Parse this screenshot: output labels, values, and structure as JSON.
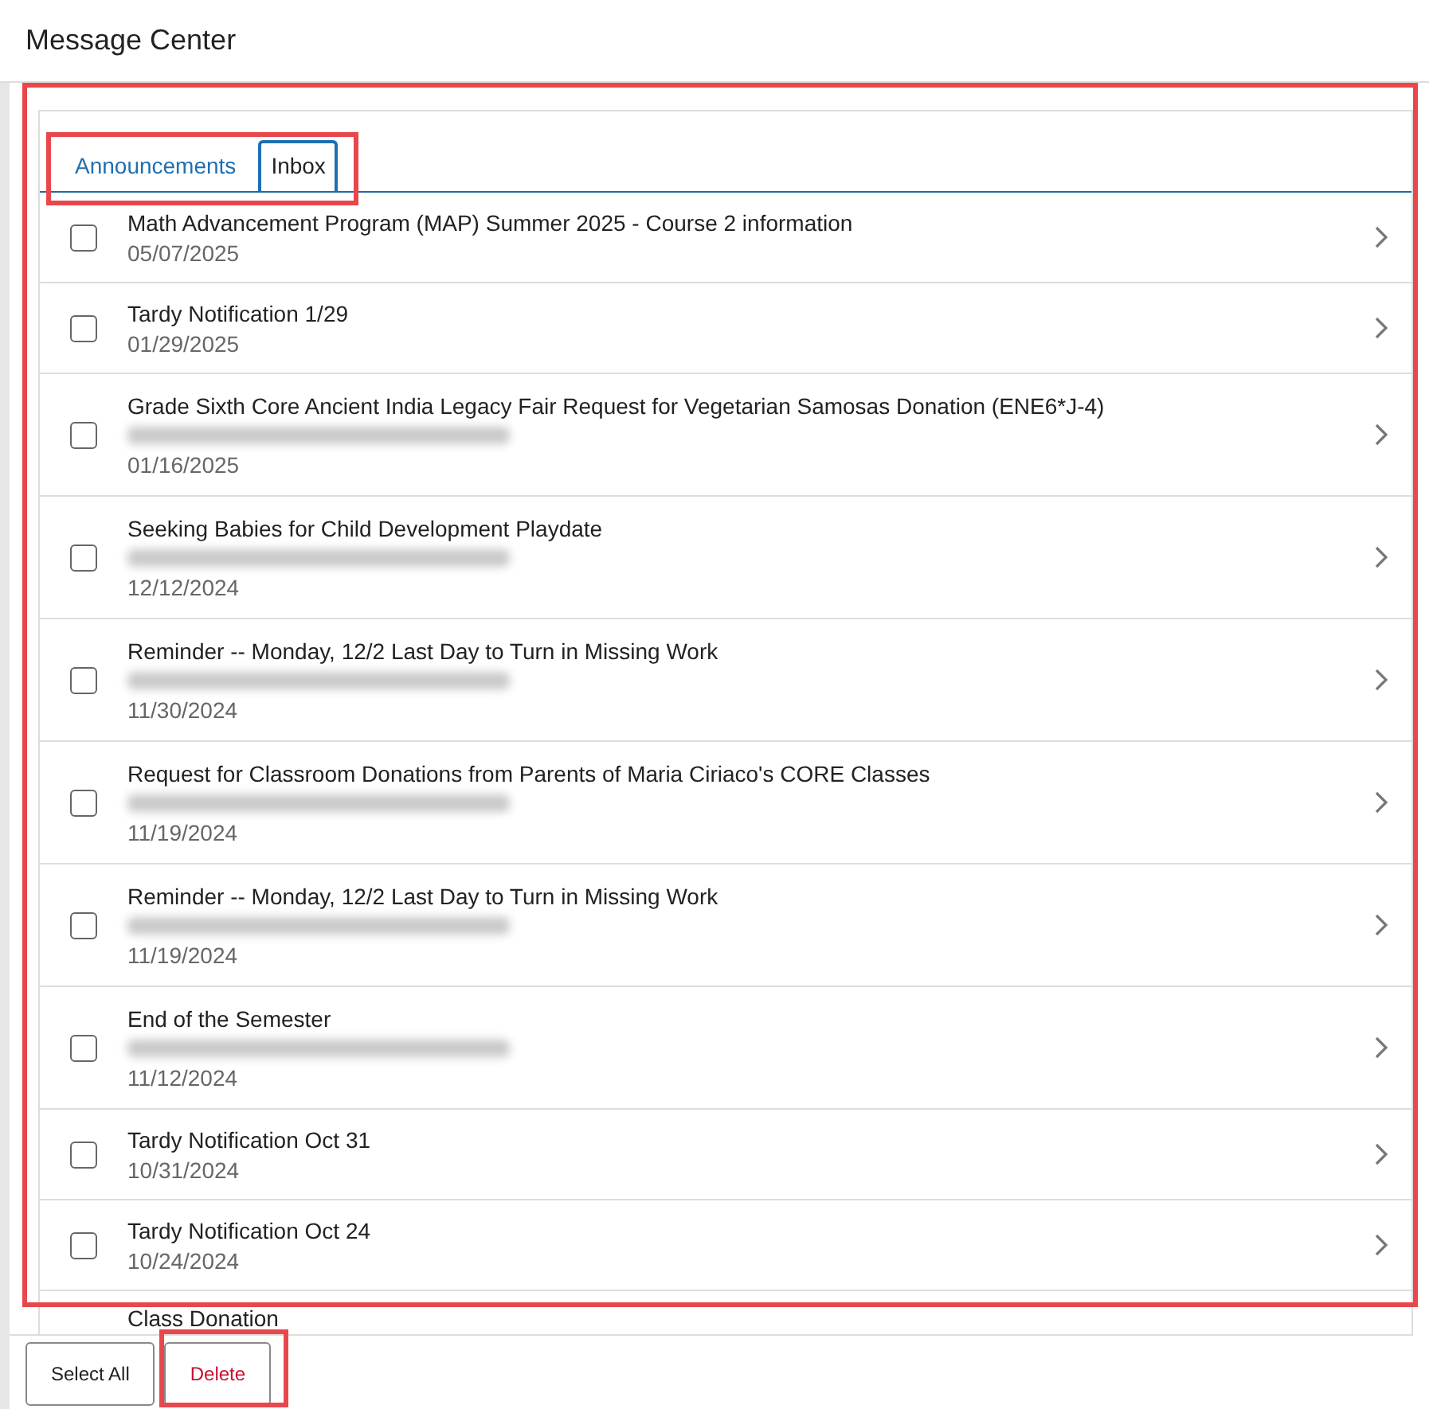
{
  "header": {
    "title": "Message Center"
  },
  "tabs": [
    {
      "label": "Announcements",
      "selected": false
    },
    {
      "label": "Inbox",
      "selected": true
    }
  ],
  "messages": [
    {
      "title": "Math Advancement Program (MAP) Summer 2025 - Course 2 information",
      "date": "05/07/2025",
      "checked": false,
      "redacted": false
    },
    {
      "title": "Tardy Notification 1/29",
      "date": "01/29/2025",
      "checked": false,
      "redacted": false
    },
    {
      "title": "Grade Sixth Core Ancient India Legacy Fair Request for Vegetarian Samosas Donation (ENE6*J-4)",
      "date": "01/16/2025",
      "checked": false,
      "redacted": true
    },
    {
      "title": "Seeking Babies for Child Development Playdate",
      "date": "12/12/2024",
      "checked": false,
      "redacted": true
    },
    {
      "title": "Reminder -- Monday, 12/2 Last Day to Turn in Missing Work",
      "date": "11/30/2024",
      "checked": false,
      "redacted": true
    },
    {
      "title": "Request for Classroom Donations from Parents of Maria Ciriaco's CORE Classes",
      "date": "11/19/2024",
      "checked": false,
      "redacted": true
    },
    {
      "title": "Reminder -- Monday, 12/2 Last Day to Turn in Missing Work",
      "date": "11/19/2024",
      "checked": false,
      "redacted": true
    },
    {
      "title": "End of the Semester",
      "date": "11/12/2024",
      "checked": false,
      "redacted": true
    },
    {
      "title": "Tardy Notification Oct 31",
      "date": "10/31/2024",
      "checked": false,
      "redacted": false
    },
    {
      "title": "Tardy Notification Oct 24",
      "date": "10/24/2024",
      "checked": false,
      "redacted": false
    },
    {
      "title": "Class Donation"
    }
  ],
  "buttons": [
    {
      "label": "Select All",
      "kind": "neutral"
    },
    {
      "label": "Delete",
      "kind": "danger"
    }
  ]
}
